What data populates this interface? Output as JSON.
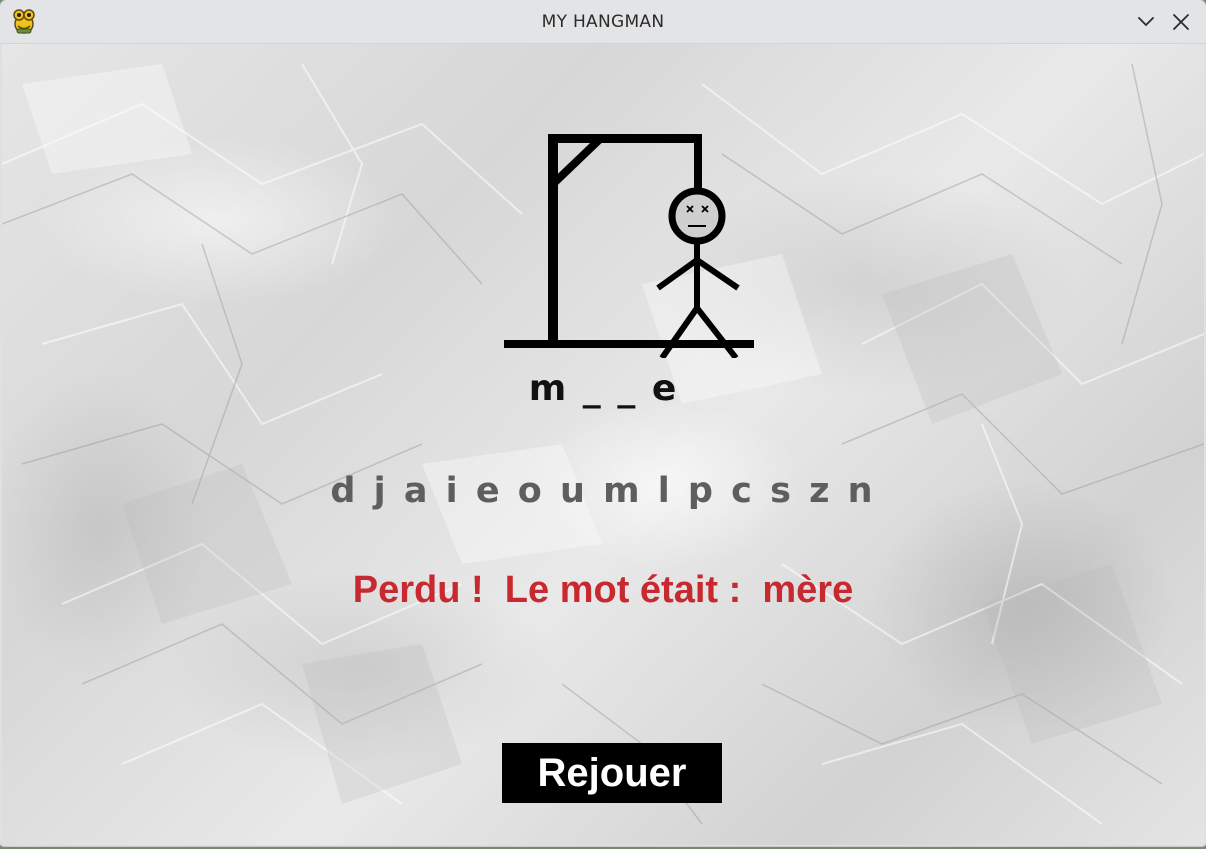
{
  "window": {
    "title": "MY HANGMAN",
    "app_icon": "python-snake-icon",
    "controls": {
      "minimize_icon": "chevron-down-icon",
      "close_icon": "close-icon"
    }
  },
  "game": {
    "masked_word": "m _ _ e",
    "guessed_letters": "d j a i e o u m l p c s z n",
    "result_message": "Perdu !  Le mot était :  mère",
    "replay_label": "Rejouer",
    "hangman_stage": "complete",
    "face": "dead-x-eyes"
  },
  "colors": {
    "titlebar": "#e3e4e6",
    "word": "#111111",
    "guessed": "#5e5e5e",
    "result": "#c8282f",
    "button_bg": "#000000",
    "button_text": "#ffffff"
  }
}
